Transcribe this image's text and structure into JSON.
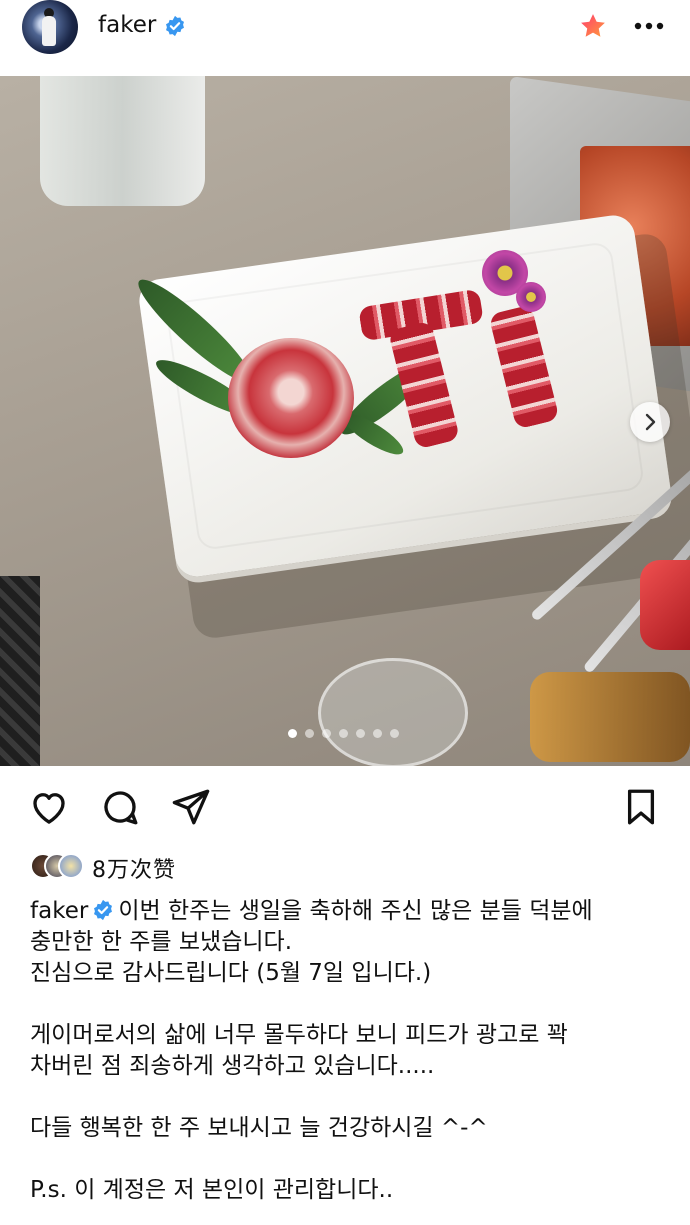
{
  "header": {
    "username": "faker",
    "verified": true,
    "favorite_icon": "star-icon",
    "more_icon": "more-icon"
  },
  "post": {
    "carousel": {
      "current_index": 1,
      "total": 7
    },
    "likes_text": "8万次赞",
    "caption_user": "faker",
    "caption_lines": [
      "이번 한주는 생일을 축하해 주신 많은 분들 덕분에",
      "충만한 한 주를 보냈습니다.",
      "진심으로 감사드립니다 (5월 7일 입니다.)",
      "",
      "게이머로서의 삶에 너무 몰두하다 보니 피드가 광고로 꽉",
      "차버린 점 죄송하게 생각하고 있습니다.....",
      "",
      "다들 행복한 한 주 보내시고 늘 건강하시길 ^-^",
      "",
      "P.s. 이 계정은 저 본인이 관리합니다.."
    ]
  },
  "colors": {
    "verified_blue": "#3897f0",
    "star_start": "#ff3d6e",
    "star_end": "#ff9a3c",
    "text": "#111111"
  },
  "icons": [
    "heart-icon",
    "comment-icon",
    "share-icon",
    "bookmark-icon",
    "chevron-right-icon"
  ]
}
